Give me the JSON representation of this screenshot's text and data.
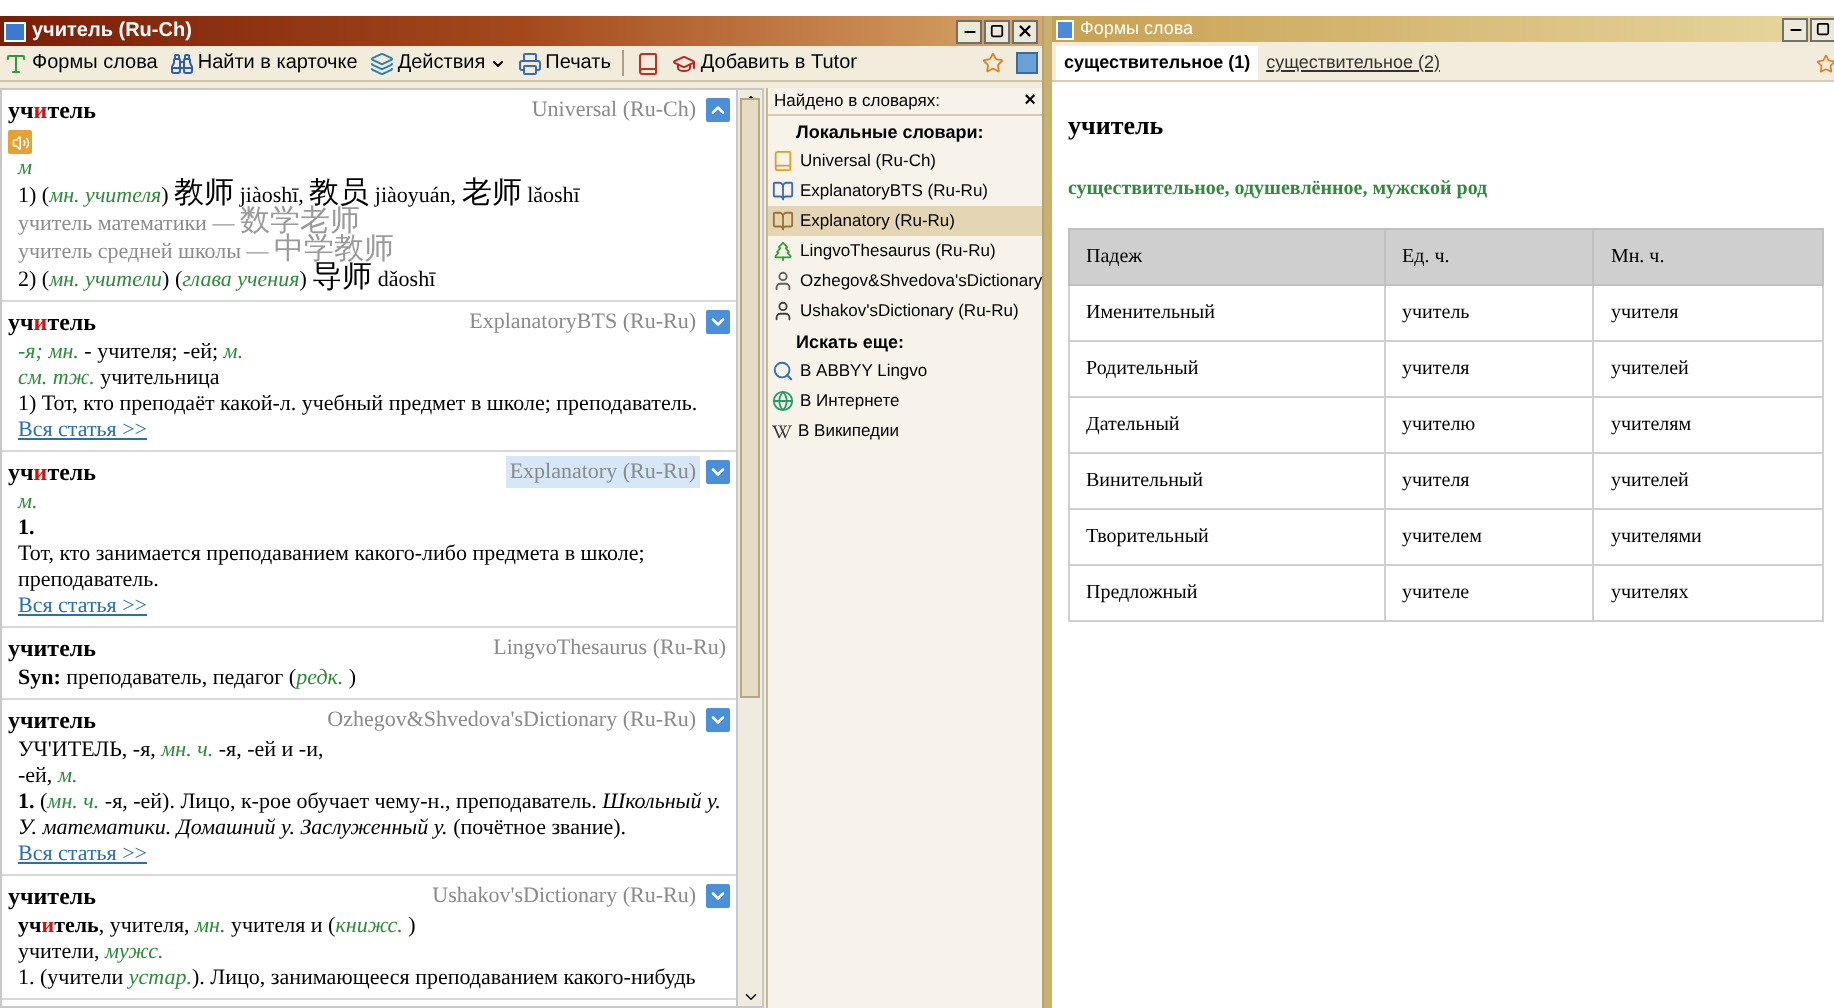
{
  "main_window": {
    "title": "учитель (Ru-Ch)",
    "toolbar": [
      {
        "label": "Формы слова",
        "dropdown": false
      },
      {
        "label": "Найти в карточке",
        "dropdown": false
      },
      {
        "label": "Действия",
        "dropdown": true
      },
      {
        "label": "Печать",
        "dropdown": false
      },
      {
        "label": "Добавить в Tutor",
        "dropdown": false
      }
    ],
    "cards": [
      {
        "headword": [
          {
            "text": "уч",
            "accent": false
          },
          {
            "text": "и",
            "accent": true
          },
          {
            "text": "тель",
            "accent": false
          }
        ],
        "dictionary": "Universal (Ru-Ch)",
        "highlighted": false,
        "sound_icon": true,
        "toggle": true,
        "expanded": true,
        "lines": [
          [
            {
              "text": "м",
              "kind": "abbr"
            }
          ],
          [
            {
              "text": "1) (",
              "kind": "text"
            },
            {
              "text": "мн. учителя",
              "kind": "abbr"
            },
            {
              "text": ") ",
              "kind": "text"
            },
            {
              "text": "教师",
              "kind": "han"
            },
            {
              "text": " jiàoshī, ",
              "kind": "text"
            },
            {
              "text": "教员",
              "kind": "han"
            },
            {
              "text": " jiàoyuán, ",
              "kind": "text"
            },
            {
              "text": "老师",
              "kind": "han"
            },
            {
              "text": " lǎoshī",
              "kind": "text"
            }
          ],
          [
            {
              "text": "учитель математики — ",
              "kind": "grey"
            },
            {
              "text": "数学老师",
              "kind": "grey_han"
            }
          ],
          [
            {
              "text": "учитель средней школы — ",
              "kind": "grey"
            },
            {
              "text": "中学教师",
              "kind": "grey_han"
            }
          ],
          [
            {
              "text": "2) (",
              "kind": "text"
            },
            {
              "text": "мн. учители",
              "kind": "abbr"
            },
            {
              "text": ") (",
              "kind": "text"
            },
            {
              "text": "глава учения",
              "kind": "abbr"
            },
            {
              "text": ") ",
              "kind": "text"
            },
            {
              "text": "导师",
              "kind": "han"
            },
            {
              "text": " dǎoshī",
              "kind": "text"
            }
          ]
        ]
      },
      {
        "headword": [
          {
            "text": "уч",
            "accent": false
          },
          {
            "text": "и",
            "accent": true
          },
          {
            "text": "тель",
            "accent": false
          }
        ],
        "dictionary": "ExplanatoryBTS (Ru-Ru)",
        "highlighted": false,
        "sound_icon": false,
        "toggle": true,
        "expanded": false,
        "lines": [
          [
            {
              "text": "-я; мн.",
              "kind": "abbr"
            },
            {
              "text": " - учителя; -ей; ",
              "kind": "text"
            },
            {
              "text": "м.",
              "kind": "abbr"
            }
          ],
          [
            {
              "text": "см. тж.",
              "kind": "abbr"
            },
            {
              "text": " учительница",
              "kind": "text"
            }
          ],
          [
            {
              "text": "1) Тот, кто преподаёт какой-л. учебный предмет в школе; преподаватель.",
              "kind": "text"
            }
          ],
          [
            {
              "text": "Вся статья >>",
              "kind": "link"
            }
          ]
        ]
      },
      {
        "headword": [
          {
            "text": "уч",
            "accent": false
          },
          {
            "text": "и",
            "accent": true
          },
          {
            "text": "тель",
            "accent": false
          }
        ],
        "dictionary": "Explanatory (Ru-Ru)",
        "highlighted": true,
        "sound_icon": false,
        "toggle": true,
        "expanded": false,
        "lines": [
          [
            {
              "text": "м.",
              "kind": "abbr"
            }
          ],
          [
            {
              "text": "1.",
              "kind": "bold"
            }
          ],
          [
            {
              "text": "Тот, кто занимается преподаванием какого-либо предмета в школе; преподаватель.",
              "kind": "text"
            }
          ],
          [
            {
              "text": "Вся статья >>",
              "kind": "link"
            }
          ]
        ]
      },
      {
        "headword": [
          {
            "text": "учитель",
            "accent": false
          }
        ],
        "dictionary": "LingvoThesaurus (Ru-Ru)",
        "highlighted": false,
        "sound_icon": false,
        "toggle": false,
        "lines": [
          [
            {
              "text": "Syn:",
              "kind": "bold"
            },
            {
              "text": " преподаватель, педагог (",
              "kind": "text"
            },
            {
              "text": "редк.",
              "kind": "abbr"
            },
            {
              "text": " )",
              "kind": "text"
            }
          ]
        ]
      },
      {
        "headword": [
          {
            "text": "учитель",
            "accent": false
          }
        ],
        "dictionary": "Ozhegov&Shvedova'sDictionary (Ru-Ru)",
        "highlighted": false,
        "sound_icon": false,
        "toggle": true,
        "expanded": false,
        "lines": [
          [
            {
              "text": "УЧ'ИТЕЛЬ, -я, ",
              "kind": "text"
            },
            {
              "text": "мн. ч.",
              "kind": "abbr"
            },
            {
              "text": " -я, -ей и -и,",
              "kind": "text"
            }
          ],
          [
            {
              "text": "-ей, ",
              "kind": "text"
            },
            {
              "text": "м.",
              "kind": "abbr"
            }
          ],
          [
            {
              "text": "1.",
              "kind": "bold"
            },
            {
              "text": " (",
              "kind": "text"
            },
            {
              "text": "мн. ч.",
              "kind": "abbr"
            },
            {
              "text": " -я, -ей). Лицо, к-рое обучает чему-н., преподаватель. ",
              "kind": "text"
            },
            {
              "text": "Школьный у. У. математики. Домашний у. Заслуженный у.",
              "kind": "italic"
            },
            {
              "text": " (почётное звание).",
              "kind": "text"
            }
          ],
          [
            {
              "text": "Вся статья >>",
              "kind": "link"
            }
          ]
        ]
      },
      {
        "headword": [
          {
            "text": "учитель",
            "accent": false
          }
        ],
        "dictionary": "Ushakov'sDictionary (Ru-Ru)",
        "highlighted": false,
        "sound_icon": false,
        "toggle": true,
        "expanded": false,
        "lines": [
          [
            {
              "text": "уч",
              "kind": "bold"
            },
            {
              "text": "и",
              "kind": "accent"
            },
            {
              "text": "тель",
              "kind": "bold"
            },
            {
              "text": ", учителя, ",
              "kind": "text"
            },
            {
              "text": "мн.",
              "kind": "abbr"
            },
            {
              "text": " учителя и (",
              "kind": "text"
            },
            {
              "text": "книжс.",
              "kind": "abbr"
            },
            {
              "text": " )",
              "kind": "text"
            }
          ],
          [
            {
              "text": "учители, ",
              "kind": "text"
            },
            {
              "text": "мужс.",
              "kind": "abbr"
            }
          ],
          [
            {
              "text": "1. (учители ",
              "kind": "text"
            },
            {
              "text": "устар.",
              "kind": "abbr"
            },
            {
              "text": "). Лицо, занимающееся преподаванием какого-нибудь",
              "kind": "text"
            }
          ]
        ]
      }
    ],
    "found_panel": {
      "title": "Найдено в словарях:",
      "close": "×",
      "sections": [
        {
          "heading": "Локальные словари:",
          "items": [
            {
              "label": "Universal (Ru-Ch)",
              "selected": false
            },
            {
              "label": "ExplanatoryBTS (Ru-Ru)",
              "selected": false
            },
            {
              "label": "Explanatory (Ru-Ru)",
              "selected": true
            },
            {
              "label": "LingvoThesaurus (Ru-Ru)",
              "selected": false
            },
            {
              "label": "Ozhegov&Shvedova'sDictionary",
              "selected": false
            },
            {
              "label": "Ushakov'sDictionary (Ru-Ru)",
              "selected": false
            }
          ]
        },
        {
          "heading": "Искать еще:",
          "items": [
            {
              "label": "В ABBYY Lingvo",
              "selected": false
            },
            {
              "label": "В Интернете",
              "selected": false
            },
            {
              "label": "В Википедии",
              "selected": false
            }
          ]
        }
      ]
    }
  },
  "forms_window": {
    "title": "Формы слова",
    "tabs": [
      {
        "label": "существительное (1)",
        "selected": true
      },
      {
        "label": "существительное (2)",
        "selected": false
      }
    ],
    "word": "учитель",
    "grammar": "существительное, одушевлённое, мужской род",
    "table": {
      "columns": [
        "Падеж",
        "Ед. ч.",
        "Мн. ч."
      ],
      "rows": [
        [
          "Именительный",
          "учитель",
          "учителя"
        ],
        [
          "Родительный",
          "учителя",
          "учителей"
        ],
        [
          "Дательный",
          "учителю",
          "учителям"
        ],
        [
          "Винительный",
          "учителя",
          "учителей"
        ],
        [
          "Творительный",
          "учителем",
          "учителями"
        ],
        [
          "Предложный",
          "учителе",
          "учителях"
        ]
      ]
    }
  }
}
